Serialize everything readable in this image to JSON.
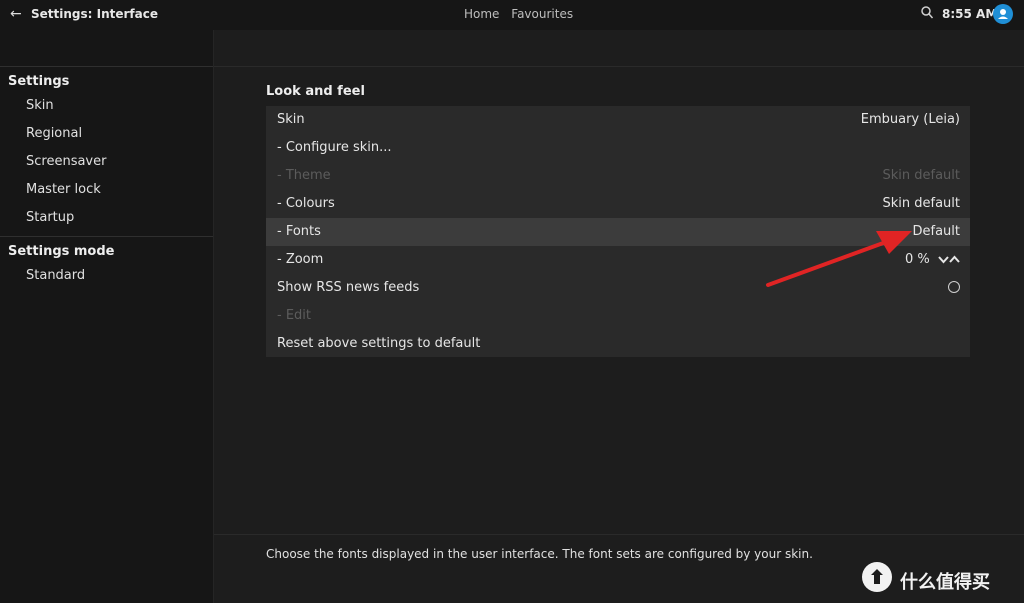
{
  "header": {
    "title": "Settings: Interface",
    "nav": [
      "Home",
      "Favourites"
    ],
    "clock": "8:55 AM"
  },
  "sidebar": {
    "section1": "Settings",
    "items": [
      "Skin",
      "Regional",
      "Screensaver",
      "Master lock",
      "Startup"
    ],
    "section2": "Settings mode",
    "mode": "Standard"
  },
  "main": {
    "group_title": "Look and feel",
    "rows": [
      {
        "label": "Skin",
        "value": "Embuary (Leia)"
      },
      {
        "label": "- Configure skin...",
        "value": ""
      },
      {
        "label": "- Theme",
        "value": "Skin default"
      },
      {
        "label": "- Colours",
        "value": "Skin default"
      },
      {
        "label": "- Fonts",
        "value": "Default"
      },
      {
        "label": "- Zoom",
        "value": "0 %"
      },
      {
        "label": "Show RSS news feeds",
        "value": ""
      },
      {
        "label": "- Edit",
        "value": ""
      },
      {
        "label": "Reset above settings to default",
        "value": ""
      }
    ]
  },
  "footer": {
    "description": "Choose the fonts displayed in the user interface. The font sets are configured by your skin."
  },
  "watermark": {
    "text": "什么值得买"
  },
  "colors": {
    "accent": "#1f8fd6",
    "arrow": "#e02424",
    "focus_row": "#3c3c3c"
  }
}
